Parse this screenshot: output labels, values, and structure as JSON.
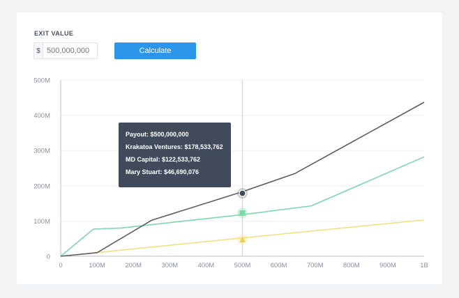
{
  "exit": {
    "label": "EXIT VALUE",
    "currency": "$",
    "placeholder": "500,000,000",
    "value": ""
  },
  "calculate_label": "Calculate",
  "tooltip": {
    "payout": "Payout: $500,000,000",
    "rows": [
      "Krakatoa Ventures: $178,533,762",
      "MD Capital: $122,533,762",
      "Mary Stuart: $46,690,076"
    ]
  },
  "chart_data": {
    "type": "line",
    "x_ticks": [
      "0",
      "100M",
      "200M",
      "300M",
      "400M",
      "500M",
      "600M",
      "700M",
      "800M",
      "900M",
      "1B"
    ],
    "y_ticks": [
      "0",
      "100M",
      "200M",
      "300M",
      "400M",
      "500M"
    ],
    "xlim": [
      0,
      1000000000
    ],
    "ylim": [
      0,
      500000000
    ],
    "grid": "horizontal",
    "hover_x": 500000000,
    "series": [
      {
        "name": "Krakatoa Ventures",
        "color": "#5b5d66",
        "marker": "circle",
        "hover_value": 178533762,
        "x": [
          0,
          100000000,
          250000000,
          500000000,
          645000000,
          1000000000
        ],
        "y": [
          0,
          10000000,
          102000000,
          183000000,
          235000000,
          437000000
        ]
      },
      {
        "name": "MD Capital",
        "color": "#7dd8a8",
        "marker": "square",
        "hover_value": 122533762,
        "x": [
          0,
          90000000,
          165000000,
          500000000,
          690000000,
          1000000000
        ],
        "y": [
          0,
          77000000,
          80000000,
          118000000,
          143000000,
          282000000
        ]
      },
      {
        "name": "Mary Stuart",
        "color": "#f4e07a",
        "marker": "triangle",
        "hover_value": 46690076,
        "x": [
          0,
          500000000,
          1000000000
        ],
        "y": [
          0,
          52000000,
          103000000
        ]
      }
    ]
  }
}
